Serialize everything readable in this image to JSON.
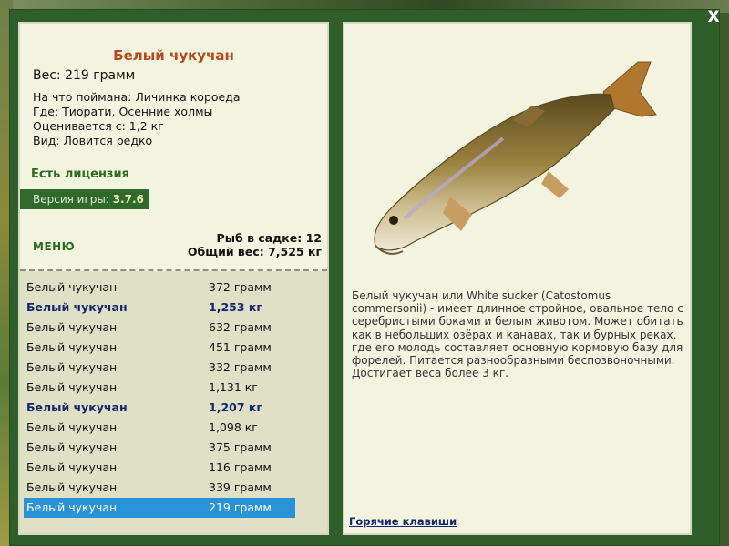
{
  "window": {
    "close_label": "X"
  },
  "fish": {
    "title": "Белый чукучан",
    "weight": "Вес: 219 грамм",
    "caught_with": "На что поймана: Личинка короеда",
    "location": "Где: Тиорати, Осенние холмы",
    "value": "Оценивается с: 1,2 кг",
    "rarity": "Вид: Ловится редко",
    "description": "Белый чукучан или White sucker (Catostomus commersonii) - имеет длинное стройное, овальное тело с серебристыми боками и белым животом. Может обитать как в небольших озёрах и канавах, так и бурных реках, где его молодь составляет основную кормовую базу для форелей. Питается разнообразными беспозвоночными. Достигает веса более 3 кг."
  },
  "license": "Есть лицензия",
  "version": {
    "label": "Версия игры:",
    "number": "3.7.6"
  },
  "menu_label": "МЕНЮ",
  "stats": {
    "fish_in_keepnet": "Рыб в садке: 12",
    "total_weight": "Общий вес: 7,525 кг"
  },
  "catch_list": [
    {
      "name": "Белый чукучан",
      "weight": "372 грамм",
      "style": "normal"
    },
    {
      "name": "Белый чукучан",
      "weight": "1,253 кг",
      "style": "bold"
    },
    {
      "name": "Белый чукучан",
      "weight": "632 грамм",
      "style": "normal"
    },
    {
      "name": "Белый чукучан",
      "weight": "451 грамм",
      "style": "normal"
    },
    {
      "name": "Белый чукучан",
      "weight": "332 грамм",
      "style": "normal"
    },
    {
      "name": "Белый чукучан",
      "weight": "1,131 кг",
      "style": "normal"
    },
    {
      "name": "Белый чукучан",
      "weight": "1,207 кг",
      "style": "bold"
    },
    {
      "name": "Белый чукучан",
      "weight": "1,098 кг",
      "style": "normal"
    },
    {
      "name": "Белый чукучан",
      "weight": "375 грамм",
      "style": "normal"
    },
    {
      "name": "Белый чукучан",
      "weight": "116 грамм",
      "style": "normal"
    },
    {
      "name": "Белый чукучан",
      "weight": "339 грамм",
      "style": "normal"
    },
    {
      "name": "Белый чукучан",
      "weight": "219 грамм",
      "style": "selected"
    }
  ],
  "hotkeys_link": "Горячие клавиши",
  "colors": {
    "title": "#b8461a",
    "accent_green": "#2f6a2b",
    "selection": "#2a93d8",
    "bold_row": "#14256e"
  }
}
